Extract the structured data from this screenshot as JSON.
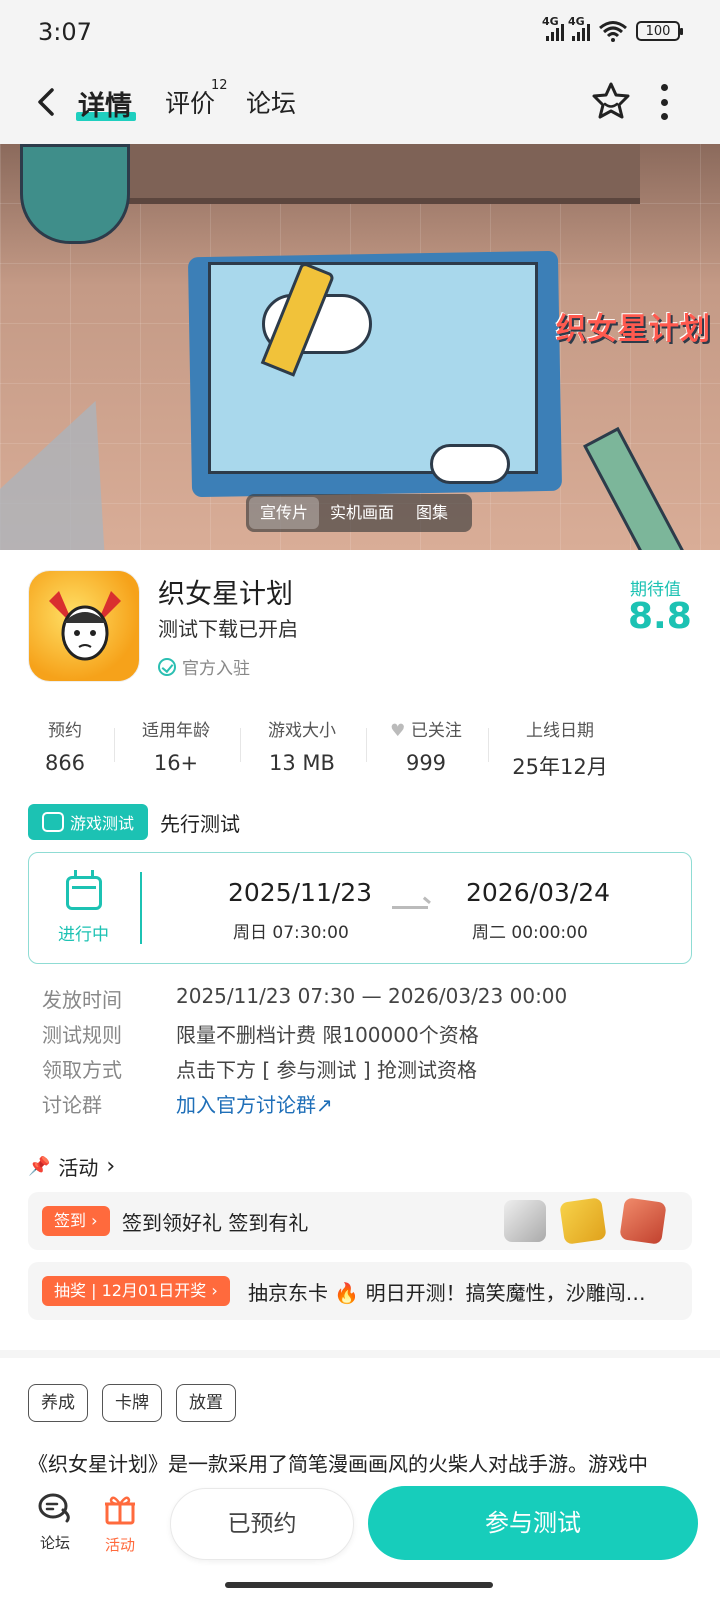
{
  "status_bar": {
    "time": "3:07",
    "signal1_label": "4G",
    "signal2_label": "4G",
    "battery": "100"
  },
  "nav": {
    "tab_detail": "详情",
    "tab_review": "评价",
    "review_count": "12",
    "tab_forum": "论坛"
  },
  "media_tabs": [
    "宣传片",
    "实机画面",
    "图集"
  ],
  "banner": {
    "game_logo": "织女星计划"
  },
  "game": {
    "title": "织女星计划",
    "subtitle": "测试下载已开启",
    "official": "官方入驻",
    "expect_label": "期待值",
    "expect_value": "8.8"
  },
  "stats": [
    {
      "label": "预约",
      "value": "866"
    },
    {
      "label": "适用年龄",
      "value": "16+"
    },
    {
      "label": "游戏大小",
      "value": "13 MB"
    },
    {
      "label": "已关注",
      "value": "999"
    },
    {
      "label": "上线日期",
      "value": "25年12月"
    }
  ],
  "test": {
    "badge": "游戏测试",
    "title": "先行测试",
    "status": "进行中",
    "start_date": "2025/11/23",
    "start_time": "周日  07:30:00",
    "end_date": "2026/03/24",
    "end_time": "周二  00:00:00"
  },
  "info_rows": [
    {
      "label": "发放时间",
      "value": "2025/11/23 07:30 — 2026/03/23 00:00"
    },
    {
      "label": "测试规则",
      "value": "限量不删档计费 限100000个资格"
    },
    {
      "label": "领取方式",
      "value": "点击下方 [ 参与测试 ] 抢测试资格"
    },
    {
      "label": "讨论群",
      "value": "加入官方讨论群↗"
    }
  ],
  "activity": {
    "heading": "活动",
    "items": [
      {
        "badge": "签到 ›",
        "text": "签到领好礼 签到有礼"
      },
      {
        "badge": "抽奖 | 12月01日开奖 ›",
        "text": "抽京东卡 🔥 明日开测！搞笑魔性，沙雕闯…"
      }
    ]
  },
  "tags": [
    "养成",
    "卡牌",
    "放置"
  ],
  "description": "《织女星计划》是一款采用了简笔漫画画风的火柴人对战手游。游戏中",
  "bottom": {
    "forum_label": "论坛",
    "activity_label": "活动",
    "reserved_button": "已预约",
    "join_button": "参与测试"
  },
  "colors": {
    "accent": "#1cc2b3",
    "orange": "#ff6a3d",
    "link": "#1f6fb8"
  }
}
